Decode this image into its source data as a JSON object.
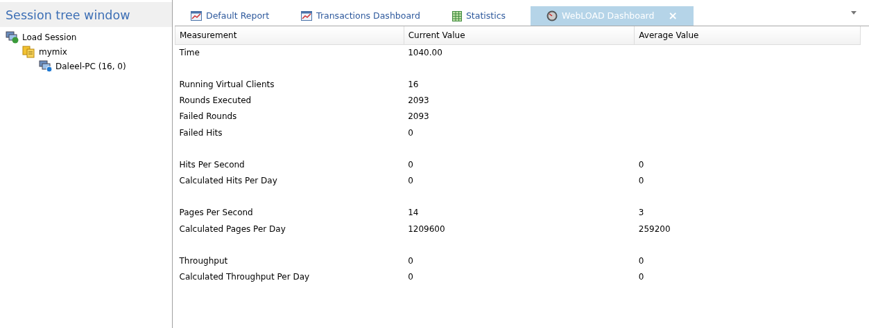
{
  "session_tree": {
    "title": "Session tree window",
    "nodes": [
      {
        "label": "Load Session",
        "kind": "session",
        "children": [
          {
            "label": "mymix",
            "kind": "mix",
            "children": [
              {
                "label": "Daleel-PC (16, 0)",
                "kind": "machine"
              }
            ]
          }
        ]
      }
    ]
  },
  "tabs": [
    {
      "label": "Default Report",
      "kind": "chart",
      "selected": false
    },
    {
      "label": "Transactions Dashboard",
      "kind": "chart",
      "selected": false
    },
    {
      "label": "Statistics",
      "kind": "grid",
      "selected": false
    },
    {
      "label": "WebLOAD Dashboard",
      "kind": "gauge",
      "selected": true,
      "close_label": "×"
    }
  ],
  "table": {
    "columns": [
      "Measurement",
      "Current Value",
      "Average Value"
    ],
    "groups": [
      {
        "rows": [
          [
            "Time",
            "1040.00",
            ""
          ]
        ]
      },
      {
        "rows": [
          [
            "Running Virtual Clients",
            "16",
            ""
          ],
          [
            "Rounds Executed",
            "2093",
            ""
          ],
          [
            "Failed Rounds",
            "2093",
            ""
          ],
          [
            "Failed Hits",
            "0",
            ""
          ]
        ]
      },
      {
        "rows": [
          [
            "Hits Per Second",
            "0",
            "0"
          ],
          [
            "Calculated Hits Per Day",
            "0",
            "0"
          ]
        ]
      },
      {
        "rows": [
          [
            "Pages Per Second",
            "14",
            "3"
          ],
          [
            "Calculated Pages Per Day",
            "1209600",
            "259200"
          ]
        ]
      },
      {
        "rows": [
          [
            "Throughput",
            "0",
            "0"
          ],
          [
            "Calculated Throughput Per Day",
            "0",
            "0"
          ]
        ]
      }
    ]
  }
}
